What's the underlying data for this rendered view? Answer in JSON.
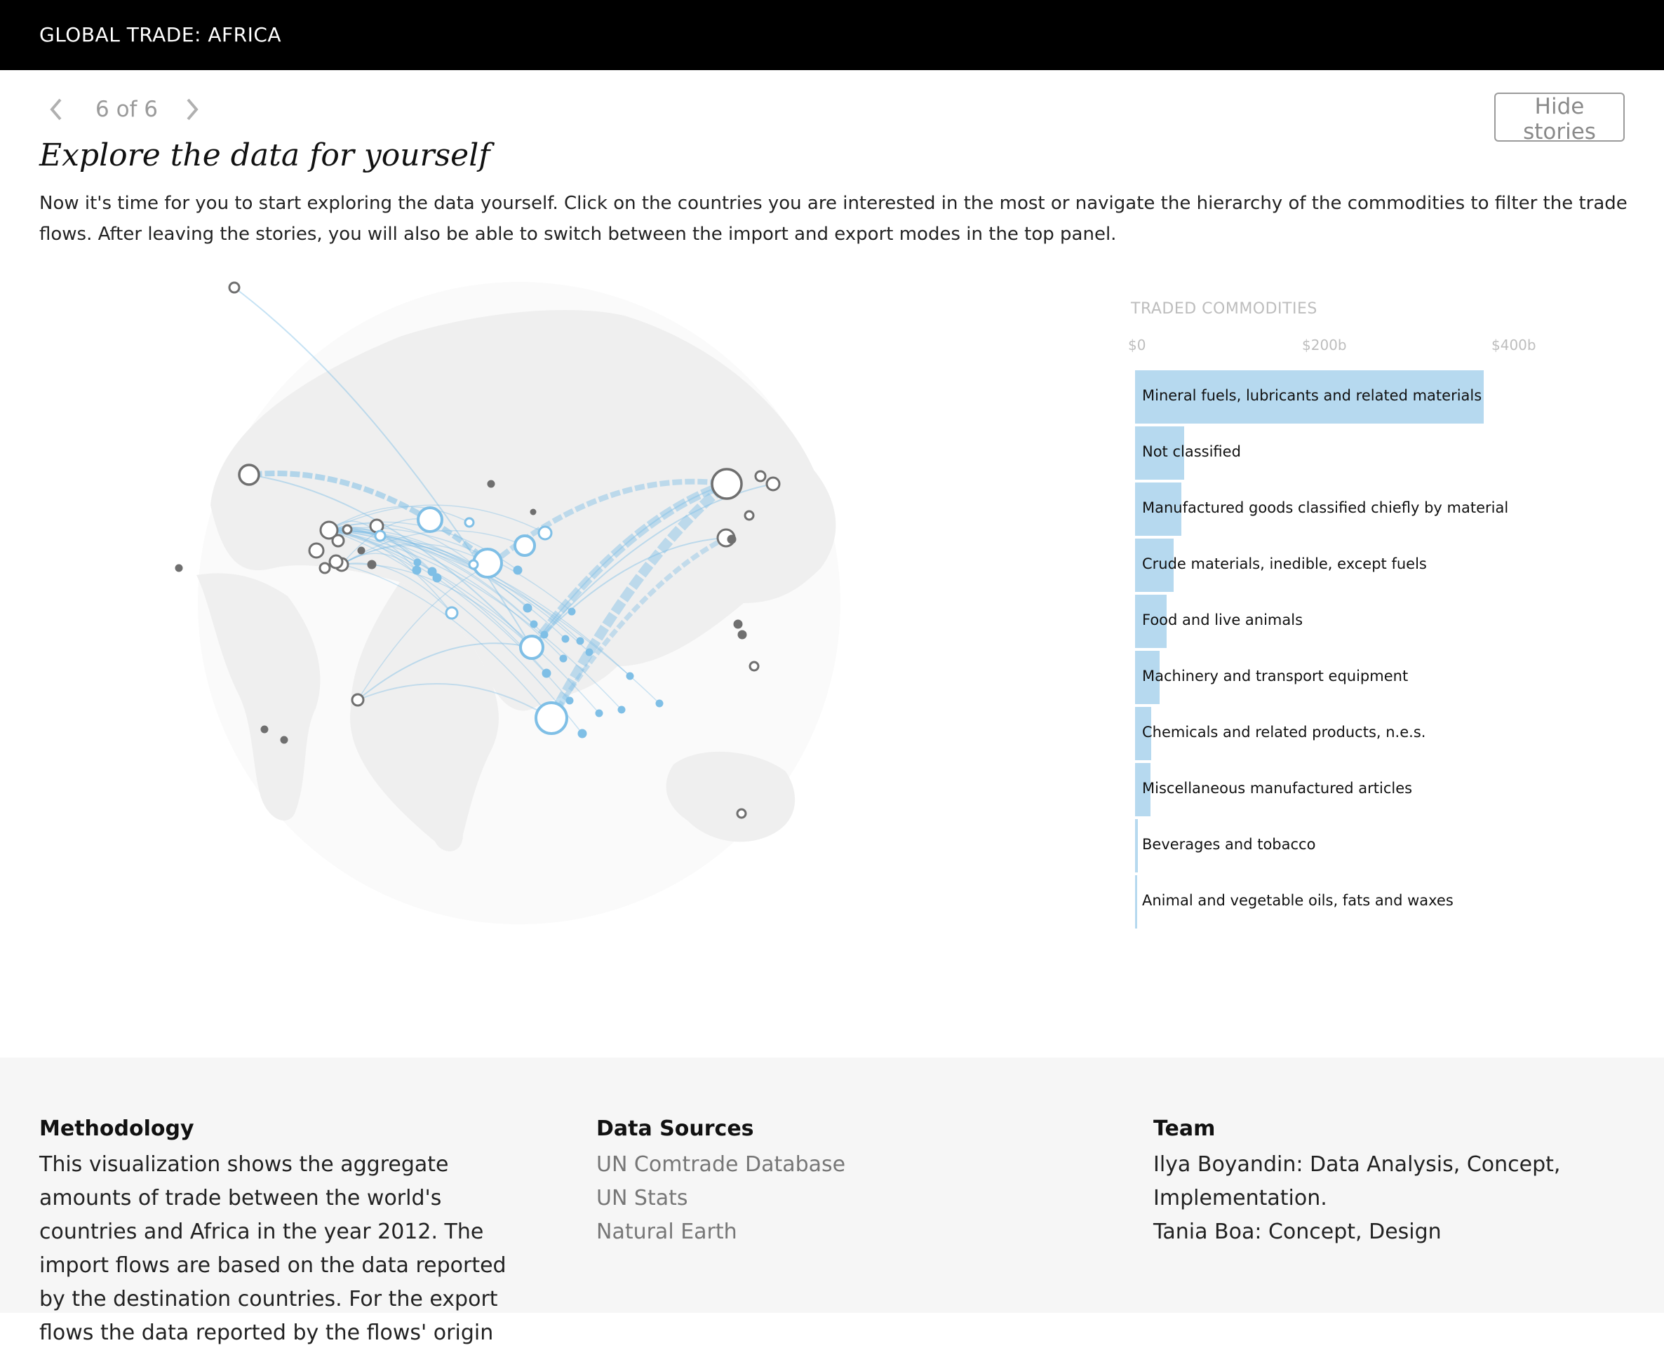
{
  "header": {
    "title": "GLOBAL TRADE: AFRICA"
  },
  "story_nav": {
    "counter": "6 of 6",
    "hide_label": "Hide stories"
  },
  "story": {
    "title": "Explore the data for yourself",
    "body": "Now it's time for you to start exploring the data yourself. Click on the countries you are interested in the most or navigate the hierarchy of the commodities to filter the trade flows. After leaving the stories, you will also be able to switch between the import and export modes in the top panel."
  },
  "commodities": {
    "title": "TRADED COMMODITIES",
    "ticks": [
      "$0",
      "$200b",
      "$400b"
    ],
    "axis_max": 400,
    "bar_color": "#b6d9ef",
    "items": [
      {
        "label": "Mineral fuels, lubricants and related materials",
        "value": 368
      },
      {
        "label": "Not classified",
        "value": 52
      },
      {
        "label": "Manufactured goods classified chiefly by material",
        "value": 49
      },
      {
        "label": "Crude materials, inedible, except fuels",
        "value": 41
      },
      {
        "label": "Food and live animals",
        "value": 33
      },
      {
        "label": "Machinery and transport equipment",
        "value": 26
      },
      {
        "label": "Chemicals and related products, n.e.s.",
        "value": 17
      },
      {
        "label": "Miscellaneous manufactured articles",
        "value": 16
      },
      {
        "label": "Beverages and tobacco",
        "value": 3
      },
      {
        "label": "Animal and vegetable oils, fats and waxes",
        "value": 2
      }
    ]
  },
  "map": {
    "africa_color": "#7fbfe6",
    "other_color": "#6f6f6f",
    "land_color": "#efefef"
  },
  "footer": {
    "methodology": {
      "title": "Methodology",
      "text": "This visualization shows the aggregate amounts of trade between the world's countries and Africa in the year 2012. The import flows are based on the data reported by the destination countries. For the export flows the data reported by the flows' origin"
    },
    "sources": {
      "title": "Data Sources",
      "links": [
        "UN Comtrade Database",
        "UN Stats",
        "Natural Earth"
      ]
    },
    "team": {
      "title": "Team",
      "members": [
        "Ilya Boyandin: Data Analysis, Concept, Implementation.",
        "Tania Boa: Concept, Design"
      ]
    }
  }
}
